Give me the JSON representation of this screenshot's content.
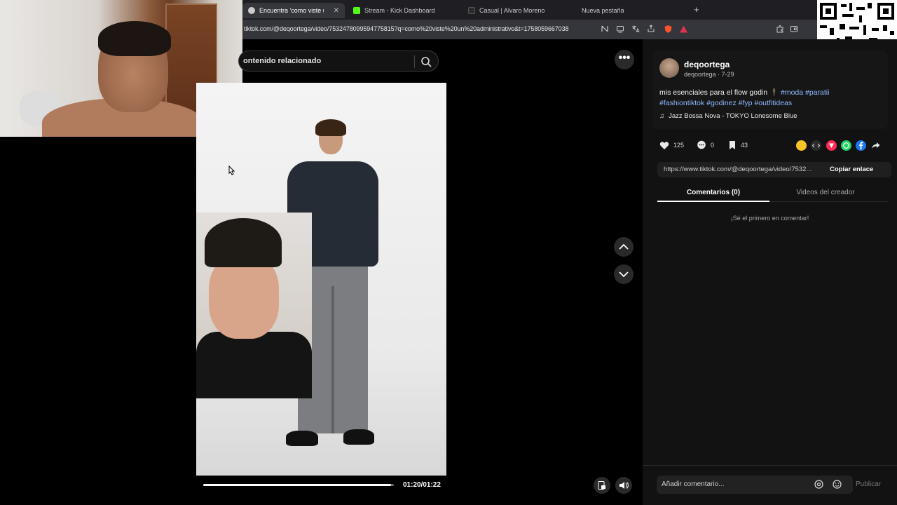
{
  "tabs": [
    {
      "label": "Encuentra 'como viste un adr",
      "active": true,
      "favicon_color": "#cccccc"
    },
    {
      "label": "Stream - Kick Dashboard",
      "active": false,
      "favicon_color": "#53fc18"
    },
    {
      "label": "Casual | Alvaro Moreno",
      "active": false,
      "favicon_color": "#2b2b2b"
    },
    {
      "label": "Nueva pestaña",
      "active": false,
      "favicon_color": "#1f1f23"
    }
  ],
  "new_tab_symbol": "+",
  "address_bar": {
    "url": "tiktok.com/@deqoortega/video/7532478099594775815?q=como%20viste%20un%20administrativo&t=1758059667038"
  },
  "search": {
    "text": "ontenido relacionado"
  },
  "player": {
    "more_symbol": "•••",
    "time": "01:20/01:22",
    "progress_fraction": 0.984
  },
  "post": {
    "author_name": "deqoortega",
    "author_meta": "deqoortega · 7-29",
    "caption_text": "mis esenciales para el flow godin 🕴",
    "hashtags_line1": "#moda #paratii",
    "hashtags_line2": "#fashiontiktok #godinez #fyp #outfitideas",
    "music_icon": "♫",
    "music": "Jazz Bossa Nova - TOKYO Lonesome Blue",
    "likes": "125",
    "comments": "0",
    "saves": "43",
    "link": "https://www.tiktok.com/@deqoortega/video/7532...",
    "copy_link_label": "Copiar enlace"
  },
  "panel_tabs": {
    "comments": "Comentarios (0)",
    "creator_videos": "Videos del creador"
  },
  "empty_comments": "¡Sé el primero en comentar!",
  "comment_box": {
    "placeholder": "Añadir comentario...",
    "publish_label": "Publicar"
  },
  "colors": {
    "accent_tag": "#8fb8ff",
    "panel_bg": "#121212",
    "kick_green": "#53fc18"
  }
}
